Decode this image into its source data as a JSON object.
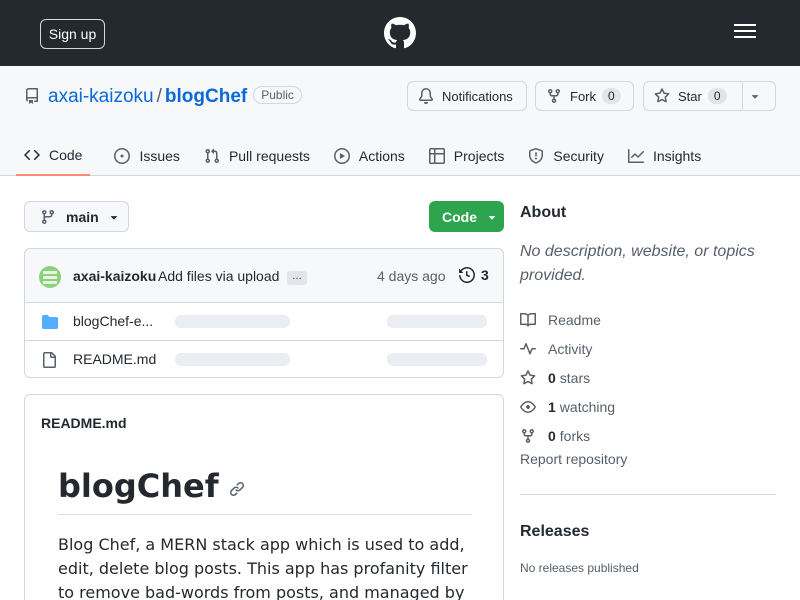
{
  "header": {
    "signup_label": "Sign up",
    "logo_icon": "github-octocat-icon",
    "menu_icon": "hamburger-menu-icon",
    "background": "#24292f"
  },
  "repo": {
    "owner": "axai-kaizoku",
    "separator": "/",
    "name": "blogChef",
    "visibility": "Public",
    "notifications_label": "Notifications",
    "fork_label": "Fork",
    "fork_count": "0",
    "star_label": "Star",
    "star_count": "0"
  },
  "tabs": [
    {
      "label": "Code",
      "icon": "code-icon",
      "active": true
    },
    {
      "label": "Issues",
      "icon": "issue-icon"
    },
    {
      "label": "Pull requests",
      "icon": "pull-request-icon"
    },
    {
      "label": "Actions",
      "icon": "play-icon"
    },
    {
      "label": "Projects",
      "icon": "table-icon"
    },
    {
      "label": "Security",
      "icon": "shield-icon"
    },
    {
      "label": "Insights",
      "icon": "graph-icon"
    }
  ],
  "branch": {
    "label": "main"
  },
  "code_button": {
    "label": "Code",
    "color": "#2da44e"
  },
  "commit": {
    "author": "axai-kaizoku",
    "message": "Add files via upload",
    "more": "…",
    "time": "4 days ago",
    "history_count": "3"
  },
  "files": [
    {
      "name": "blogChef-e...",
      "type": "folder"
    },
    {
      "name": "README.md",
      "type": "file"
    }
  ],
  "readme": {
    "filename": "README.md",
    "title": "blogChef",
    "body": "Blog Chef, a MERN stack app which is used to add, edit, delete blog posts. This app has profanity filter to remove bad-words from posts, and managed by admins."
  },
  "about": {
    "title": "About",
    "description": "No description, website, or topics provided.",
    "readme_label": "Readme",
    "activity_label": "Activity",
    "stars_count": "0",
    "stars_label": "stars",
    "watching_count": "1",
    "watching_label": "watching",
    "forks_count": "0",
    "forks_label": "forks",
    "report_label": "Report repository"
  },
  "releases": {
    "title": "Releases",
    "none_label": "No releases published"
  },
  "colors": {
    "link": "#0969da",
    "tab_underline": "#fd8c73",
    "muted": "#57606a"
  }
}
